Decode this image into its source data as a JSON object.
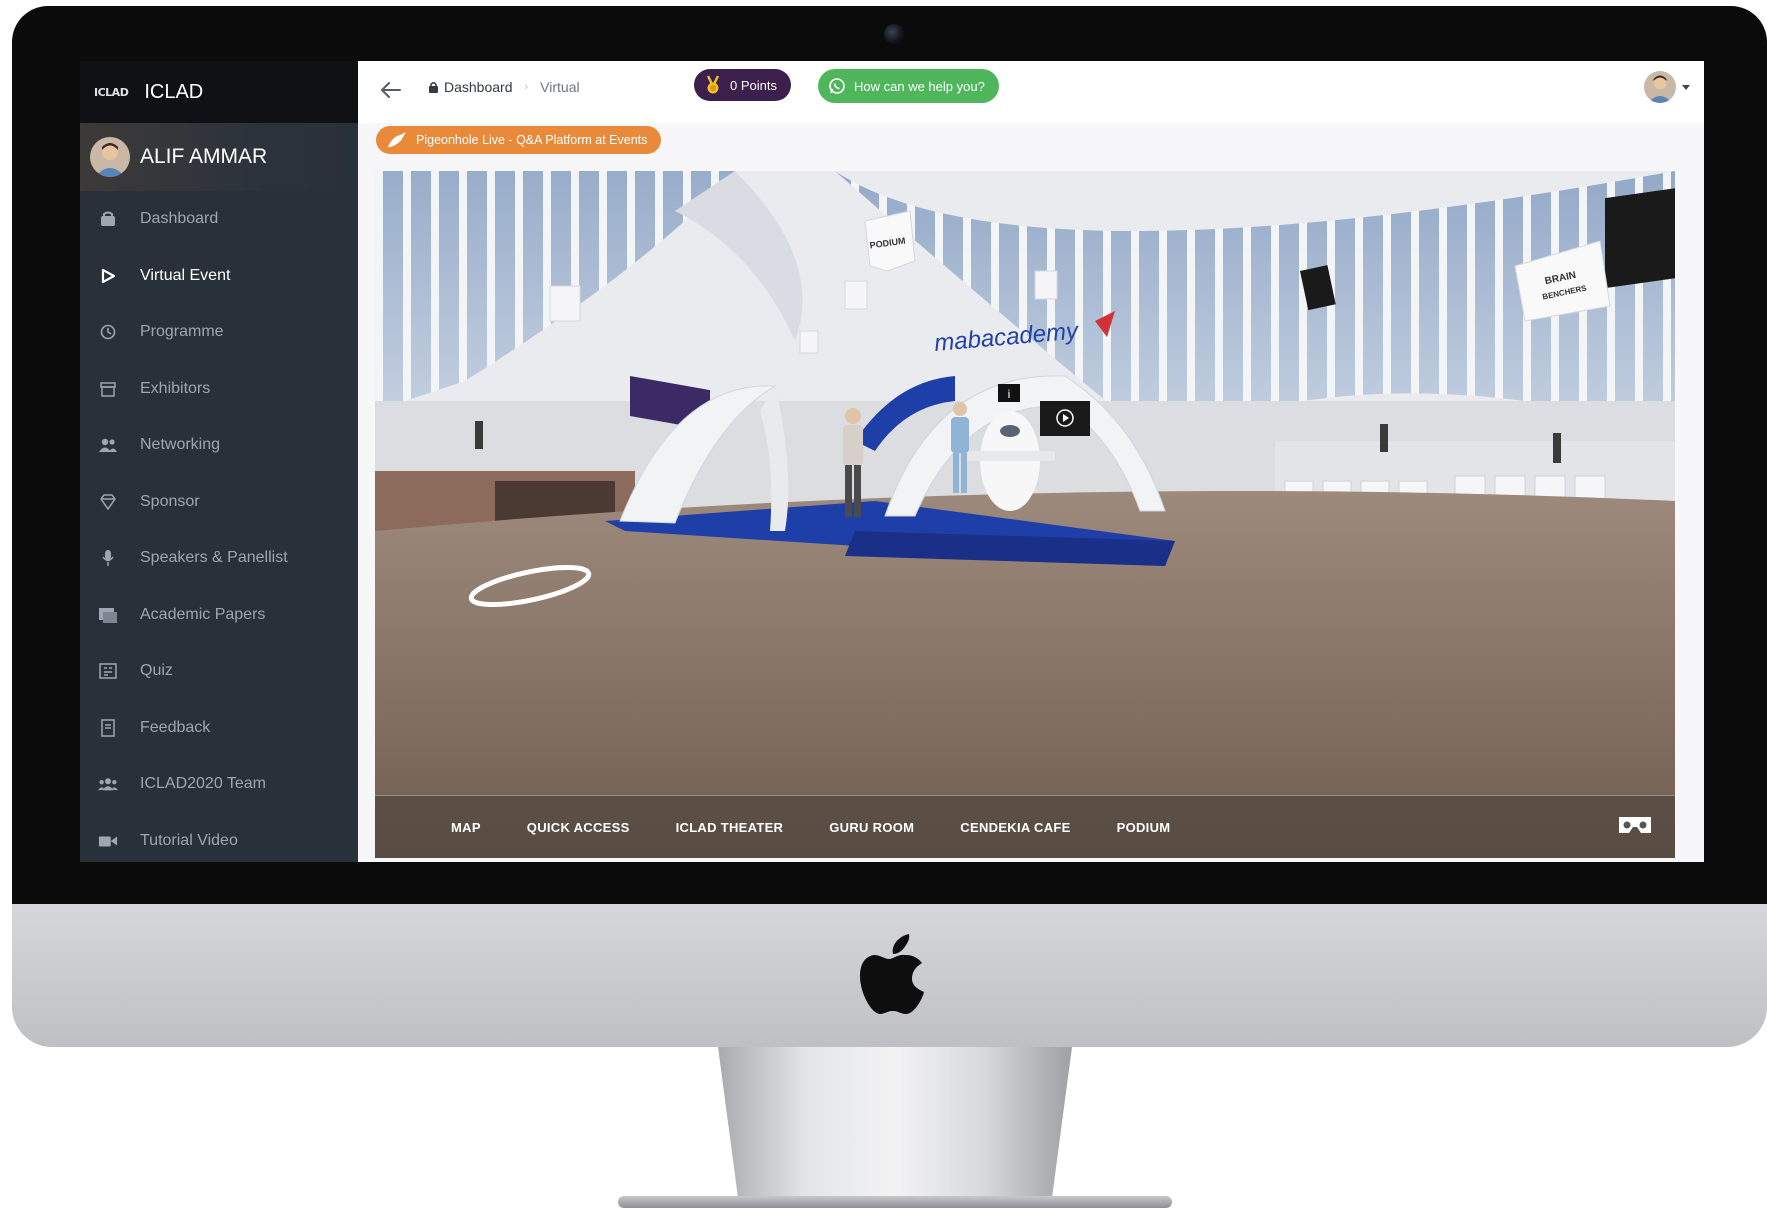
{
  "app": {
    "logo_text": "ICLAD",
    "brand_name": "ICLAD"
  },
  "user": {
    "name": "ALIF AMMAR"
  },
  "sidebar": {
    "items": [
      {
        "label": "Dashboard",
        "icon": "dashboard-icon",
        "active": false
      },
      {
        "label": "Virtual Event",
        "icon": "play-icon",
        "active": true
      },
      {
        "label": "Programme",
        "icon": "clock-icon",
        "active": false
      },
      {
        "label": "Exhibitors",
        "icon": "booth-icon",
        "active": false
      },
      {
        "label": "Networking",
        "icon": "users-icon",
        "active": false
      },
      {
        "label": "Sponsor",
        "icon": "diamond-icon",
        "active": false
      },
      {
        "label": "Speakers & Panellist",
        "icon": "microphone-icon",
        "active": false
      },
      {
        "label": "Academic Papers",
        "icon": "papers-icon",
        "active": false
      },
      {
        "label": "Quiz",
        "icon": "quiz-icon",
        "active": false
      },
      {
        "label": "Feedback",
        "icon": "feedback-icon",
        "active": false
      },
      {
        "label": "ICLAD2020 Team",
        "icon": "team-icon",
        "active": false
      },
      {
        "label": "Tutorial Video",
        "icon": "video-camera-icon",
        "active": false
      }
    ]
  },
  "header": {
    "breadcrumb": [
      {
        "label": "Dashboard",
        "icon": "lock-icon"
      },
      {
        "label": "Virtual"
      }
    ],
    "points": "0 Points",
    "help_label": "How can we help you?",
    "pigeonhole_label": "Pigeonhole Live - Q&A Platform at Events"
  },
  "viewer": {
    "tabs": [
      "MAP",
      "QUICK ACCESS",
      "ICLAD THEATER",
      "GURU ROOM",
      "CENDEKIA CAFE",
      "PODIUM"
    ],
    "scene_signs": {
      "podium": "PODIUM",
      "brand": "mabacademy",
      "brain": "BRAIN",
      "benchers": "BENCHERS"
    }
  },
  "colors": {
    "sidebar_bg": "#28303a",
    "brand_bar_bg": "#101114",
    "points_bg": "#3c1f4d",
    "help_bg": "#4fb65c",
    "pigeonhole_bg": "#e88a3a",
    "scene_blue": "#1f3fa8"
  }
}
